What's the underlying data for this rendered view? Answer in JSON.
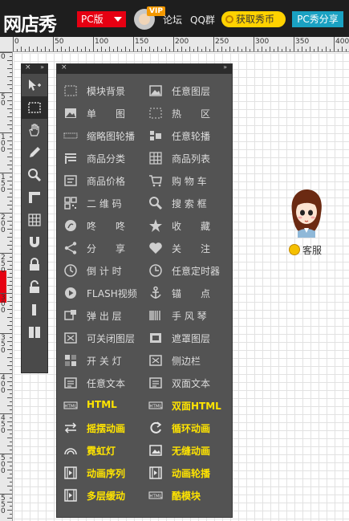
{
  "header": {
    "logo": "网店秀",
    "edition": "PC版",
    "vip_badge": "VIP",
    "forum": "论坛",
    "qq_group": "QQ群",
    "coin_button": "获取秀币",
    "share_button": "PC秀分享"
  },
  "ruler": {
    "h_labels": [
      "0",
      "50",
      "100",
      "150",
      "200",
      "250",
      "300",
      "350",
      "400"
    ],
    "v_labels": [
      "0",
      "50",
      "100",
      "150",
      "200",
      "250",
      "300",
      "350",
      "400",
      "450",
      "500",
      "550"
    ]
  },
  "toolbar": {
    "close": "×",
    "collapse": "»",
    "tools": [
      "move-tool-icon",
      "select-tool-icon",
      "hand-tool-icon",
      "pencil-icon",
      "zoom-icon",
      "ruler-icon",
      "grid-icon",
      "magnet-icon",
      "lock-icon",
      "unlock-icon",
      "single-column-icon",
      "double-column-icon"
    ]
  },
  "panel": {
    "close": "×",
    "collapse": "»",
    "items": [
      {
        "label": "模块背景",
        "icon": "module-background-icon"
      },
      {
        "label": "任意图层",
        "icon": "image-layer-icon"
      },
      {
        "label": "单　　图",
        "icon": "single-image-icon"
      },
      {
        "label": "热　　区",
        "icon": "hotspot-icon"
      },
      {
        "label": "缩略图轮播",
        "icon": "thumbnail-carousel-icon"
      },
      {
        "label": "任意轮播",
        "icon": "carousel-icon"
      },
      {
        "label": "商品分类",
        "icon": "product-category-icon"
      },
      {
        "label": "商品列表",
        "icon": "product-list-icon"
      },
      {
        "label": "商品价格",
        "icon": "product-price-icon"
      },
      {
        "label": "购 物 车",
        "icon": "shopping-cart-icon"
      },
      {
        "label": "二 维 码",
        "icon": "qr-code-icon"
      },
      {
        "label": "搜 索 框",
        "icon": "search-box-icon"
      },
      {
        "label": "咚　　咚",
        "icon": "dongdong-icon"
      },
      {
        "label": "收　　藏",
        "icon": "favorite-icon"
      },
      {
        "label": "分　　享",
        "icon": "share-icon"
      },
      {
        "label": "关　　注",
        "icon": "follow-heart-icon"
      },
      {
        "label": "倒 计 时",
        "icon": "countdown-icon"
      },
      {
        "label": "任意定时器",
        "icon": "timer-icon"
      },
      {
        "label": "FLASH视频",
        "icon": "video-play-icon"
      },
      {
        "label": "锚　　点",
        "icon": "anchor-icon"
      },
      {
        "label": "弹 出 层",
        "icon": "popup-layer-icon"
      },
      {
        "label": "手 风 琴",
        "icon": "accordion-icon"
      },
      {
        "label": "可关闭图层",
        "icon": "closable-layer-icon"
      },
      {
        "label": "遮罩图层",
        "icon": "mask-layer-icon"
      },
      {
        "label": "开 关 灯",
        "icon": "light-switch-icon"
      },
      {
        "label": "侧边栏",
        "icon": "sidebar-icon"
      },
      {
        "label": "任意文本",
        "icon": "text-icon"
      },
      {
        "label": "双面文本",
        "icon": "double-text-icon"
      },
      {
        "label": "HTML",
        "icon": "html-icon",
        "highlight": true
      },
      {
        "label": "双面HTML",
        "icon": "double-html-icon",
        "highlight": true
      },
      {
        "label": "摇摆动画",
        "icon": "swing-animation-icon",
        "highlight": true
      },
      {
        "label": "循环动画",
        "icon": "loop-animation-icon",
        "highlight": true
      },
      {
        "label": "霓虹灯",
        "icon": "neon-icon",
        "highlight": true
      },
      {
        "label": "无缝动画",
        "icon": "seamless-animation-icon",
        "highlight": true
      },
      {
        "label": "动画序列",
        "icon": "animation-sequence-icon",
        "highlight": true
      },
      {
        "label": "动画轮播",
        "icon": "animation-carousel-icon",
        "highlight": true
      },
      {
        "label": "多层缓动",
        "icon": "multilayer-easing-icon",
        "highlight": true
      },
      {
        "label": "酷模块",
        "icon": "cool-module-icon",
        "highlight": true
      }
    ]
  },
  "customer_service": {
    "label": "客服"
  }
}
